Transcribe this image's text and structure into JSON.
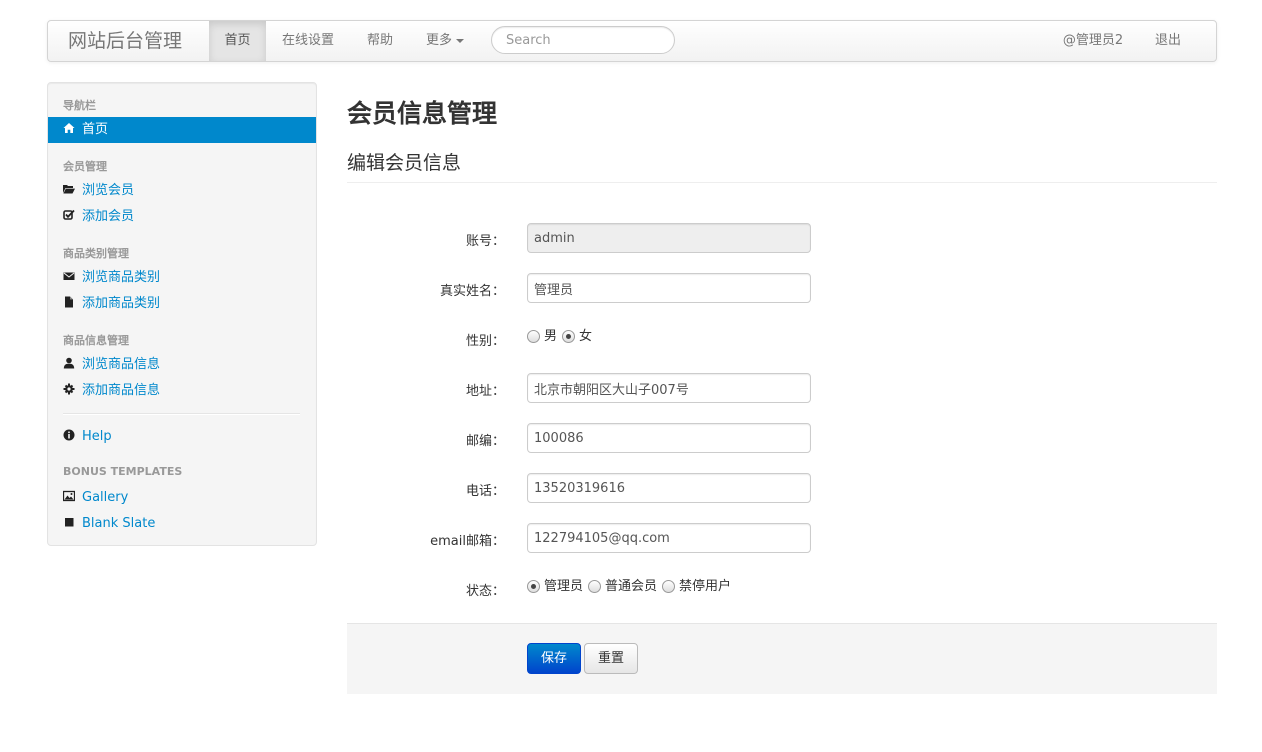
{
  "navbar": {
    "brand": "网站后台管理",
    "items": [
      "首页",
      "在线设置",
      "帮助",
      "更多"
    ],
    "search_placeholder": "Search",
    "user": "@管理员2",
    "logout": "退出"
  },
  "sidebar": {
    "headers": [
      "导航栏",
      "会员管理",
      "商品类别管理",
      "商品信息管理",
      "BONUS TEMPLATES"
    ],
    "items": [
      {
        "label": "首页",
        "icon": "home-icon"
      },
      {
        "label": "浏览会员",
        "icon": "folder-open-icon"
      },
      {
        "label": "添加会员",
        "icon": "check-icon"
      },
      {
        "label": "浏览商品类别",
        "icon": "envelope-icon"
      },
      {
        "label": "添加商品类别",
        "icon": "file-icon"
      },
      {
        "label": "浏览商品信息",
        "icon": "user-icon"
      },
      {
        "label": "添加商品信息",
        "icon": "cog-icon"
      },
      {
        "label": "Help",
        "icon": "info-icon"
      },
      {
        "label": "Gallery",
        "icon": "picture-icon"
      },
      {
        "label": "Blank Slate",
        "icon": "stop-icon"
      }
    ]
  },
  "main": {
    "title": "会员信息管理",
    "subtitle": "编辑会员信息"
  },
  "form": {
    "account_label": "账号：",
    "account_value": "admin",
    "realname_label": "真实姓名：",
    "realname_value": "管理员",
    "gender_label": "性别：",
    "gender_options": [
      "男",
      "女"
    ],
    "gender_selected": "女",
    "address_label": "地址：",
    "address_value": "北京市朝阳区大山子007号",
    "zip_label": "邮编：",
    "zip_value": "100086",
    "phone_label": "电话：",
    "phone_value": "13520319616",
    "email_label": "email邮箱：",
    "email_value": "122794105@qq.com",
    "status_label": "状态：",
    "status_options": [
      "管理员",
      "普通会员",
      "禁停用户"
    ],
    "status_selected": "管理员",
    "save_label": "保存",
    "reset_label": "重置"
  },
  "colors": {
    "link": "#0088cc",
    "primary_button": "#0044cc",
    "sidebar_active": "#0088cc"
  }
}
